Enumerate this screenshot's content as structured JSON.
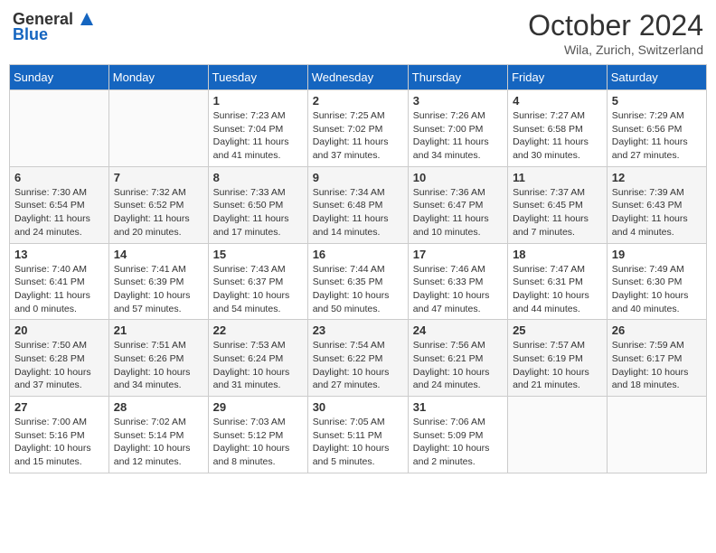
{
  "header": {
    "logo_general": "General",
    "logo_blue": "Blue",
    "month_title": "October 2024",
    "location": "Wila, Zurich, Switzerland"
  },
  "days_of_week": [
    "Sunday",
    "Monday",
    "Tuesday",
    "Wednesday",
    "Thursday",
    "Friday",
    "Saturday"
  ],
  "weeks": [
    [
      {
        "day": "",
        "sunrise": "",
        "sunset": "",
        "daylight": ""
      },
      {
        "day": "",
        "sunrise": "",
        "sunset": "",
        "daylight": ""
      },
      {
        "day": "1",
        "sunrise": "Sunrise: 7:23 AM",
        "sunset": "Sunset: 7:04 PM",
        "daylight": "Daylight: 11 hours and 41 minutes."
      },
      {
        "day": "2",
        "sunrise": "Sunrise: 7:25 AM",
        "sunset": "Sunset: 7:02 PM",
        "daylight": "Daylight: 11 hours and 37 minutes."
      },
      {
        "day": "3",
        "sunrise": "Sunrise: 7:26 AM",
        "sunset": "Sunset: 7:00 PM",
        "daylight": "Daylight: 11 hours and 34 minutes."
      },
      {
        "day": "4",
        "sunrise": "Sunrise: 7:27 AM",
        "sunset": "Sunset: 6:58 PM",
        "daylight": "Daylight: 11 hours and 30 minutes."
      },
      {
        "day": "5",
        "sunrise": "Sunrise: 7:29 AM",
        "sunset": "Sunset: 6:56 PM",
        "daylight": "Daylight: 11 hours and 27 minutes."
      }
    ],
    [
      {
        "day": "6",
        "sunrise": "Sunrise: 7:30 AM",
        "sunset": "Sunset: 6:54 PM",
        "daylight": "Daylight: 11 hours and 24 minutes."
      },
      {
        "day": "7",
        "sunrise": "Sunrise: 7:32 AM",
        "sunset": "Sunset: 6:52 PM",
        "daylight": "Daylight: 11 hours and 20 minutes."
      },
      {
        "day": "8",
        "sunrise": "Sunrise: 7:33 AM",
        "sunset": "Sunset: 6:50 PM",
        "daylight": "Daylight: 11 hours and 17 minutes."
      },
      {
        "day": "9",
        "sunrise": "Sunrise: 7:34 AM",
        "sunset": "Sunset: 6:48 PM",
        "daylight": "Daylight: 11 hours and 14 minutes."
      },
      {
        "day": "10",
        "sunrise": "Sunrise: 7:36 AM",
        "sunset": "Sunset: 6:47 PM",
        "daylight": "Daylight: 11 hours and 10 minutes."
      },
      {
        "day": "11",
        "sunrise": "Sunrise: 7:37 AM",
        "sunset": "Sunset: 6:45 PM",
        "daylight": "Daylight: 11 hours and 7 minutes."
      },
      {
        "day": "12",
        "sunrise": "Sunrise: 7:39 AM",
        "sunset": "Sunset: 6:43 PM",
        "daylight": "Daylight: 11 hours and 4 minutes."
      }
    ],
    [
      {
        "day": "13",
        "sunrise": "Sunrise: 7:40 AM",
        "sunset": "Sunset: 6:41 PM",
        "daylight": "Daylight: 11 hours and 0 minutes."
      },
      {
        "day": "14",
        "sunrise": "Sunrise: 7:41 AM",
        "sunset": "Sunset: 6:39 PM",
        "daylight": "Daylight: 10 hours and 57 minutes."
      },
      {
        "day": "15",
        "sunrise": "Sunrise: 7:43 AM",
        "sunset": "Sunset: 6:37 PM",
        "daylight": "Daylight: 10 hours and 54 minutes."
      },
      {
        "day": "16",
        "sunrise": "Sunrise: 7:44 AM",
        "sunset": "Sunset: 6:35 PM",
        "daylight": "Daylight: 10 hours and 50 minutes."
      },
      {
        "day": "17",
        "sunrise": "Sunrise: 7:46 AM",
        "sunset": "Sunset: 6:33 PM",
        "daylight": "Daylight: 10 hours and 47 minutes."
      },
      {
        "day": "18",
        "sunrise": "Sunrise: 7:47 AM",
        "sunset": "Sunset: 6:31 PM",
        "daylight": "Daylight: 10 hours and 44 minutes."
      },
      {
        "day": "19",
        "sunrise": "Sunrise: 7:49 AM",
        "sunset": "Sunset: 6:30 PM",
        "daylight": "Daylight: 10 hours and 40 minutes."
      }
    ],
    [
      {
        "day": "20",
        "sunrise": "Sunrise: 7:50 AM",
        "sunset": "Sunset: 6:28 PM",
        "daylight": "Daylight: 10 hours and 37 minutes."
      },
      {
        "day": "21",
        "sunrise": "Sunrise: 7:51 AM",
        "sunset": "Sunset: 6:26 PM",
        "daylight": "Daylight: 10 hours and 34 minutes."
      },
      {
        "day": "22",
        "sunrise": "Sunrise: 7:53 AM",
        "sunset": "Sunset: 6:24 PM",
        "daylight": "Daylight: 10 hours and 31 minutes."
      },
      {
        "day": "23",
        "sunrise": "Sunrise: 7:54 AM",
        "sunset": "Sunset: 6:22 PM",
        "daylight": "Daylight: 10 hours and 27 minutes."
      },
      {
        "day": "24",
        "sunrise": "Sunrise: 7:56 AM",
        "sunset": "Sunset: 6:21 PM",
        "daylight": "Daylight: 10 hours and 24 minutes."
      },
      {
        "day": "25",
        "sunrise": "Sunrise: 7:57 AM",
        "sunset": "Sunset: 6:19 PM",
        "daylight": "Daylight: 10 hours and 21 minutes."
      },
      {
        "day": "26",
        "sunrise": "Sunrise: 7:59 AM",
        "sunset": "Sunset: 6:17 PM",
        "daylight": "Daylight: 10 hours and 18 minutes."
      }
    ],
    [
      {
        "day": "27",
        "sunrise": "Sunrise: 7:00 AM",
        "sunset": "Sunset: 5:16 PM",
        "daylight": "Daylight: 10 hours and 15 minutes."
      },
      {
        "day": "28",
        "sunrise": "Sunrise: 7:02 AM",
        "sunset": "Sunset: 5:14 PM",
        "daylight": "Daylight: 10 hours and 12 minutes."
      },
      {
        "day": "29",
        "sunrise": "Sunrise: 7:03 AM",
        "sunset": "Sunset: 5:12 PM",
        "daylight": "Daylight: 10 hours and 8 minutes."
      },
      {
        "day": "30",
        "sunrise": "Sunrise: 7:05 AM",
        "sunset": "Sunset: 5:11 PM",
        "daylight": "Daylight: 10 hours and 5 minutes."
      },
      {
        "day": "31",
        "sunrise": "Sunrise: 7:06 AM",
        "sunset": "Sunset: 5:09 PM",
        "daylight": "Daylight: 10 hours and 2 minutes."
      },
      {
        "day": "",
        "sunrise": "",
        "sunset": "",
        "daylight": ""
      },
      {
        "day": "",
        "sunrise": "",
        "sunset": "",
        "daylight": ""
      }
    ]
  ]
}
